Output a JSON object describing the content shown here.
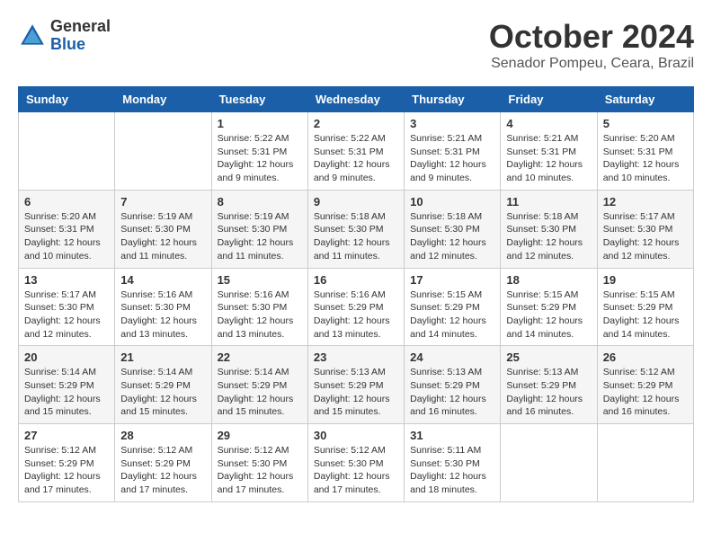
{
  "logo": {
    "general": "General",
    "blue": "Blue"
  },
  "title": "October 2024",
  "subtitle": "Senador Pompeu, Ceara, Brazil",
  "headers": [
    "Sunday",
    "Monday",
    "Tuesday",
    "Wednesday",
    "Thursday",
    "Friday",
    "Saturday"
  ],
  "weeks": [
    [
      {
        "day": "",
        "info": ""
      },
      {
        "day": "",
        "info": ""
      },
      {
        "day": "1",
        "info": "Sunrise: 5:22 AM\nSunset: 5:31 PM\nDaylight: 12 hours and 9 minutes."
      },
      {
        "day": "2",
        "info": "Sunrise: 5:22 AM\nSunset: 5:31 PM\nDaylight: 12 hours and 9 minutes."
      },
      {
        "day": "3",
        "info": "Sunrise: 5:21 AM\nSunset: 5:31 PM\nDaylight: 12 hours and 9 minutes."
      },
      {
        "day": "4",
        "info": "Sunrise: 5:21 AM\nSunset: 5:31 PM\nDaylight: 12 hours and 10 minutes."
      },
      {
        "day": "5",
        "info": "Sunrise: 5:20 AM\nSunset: 5:31 PM\nDaylight: 12 hours and 10 minutes."
      }
    ],
    [
      {
        "day": "6",
        "info": "Sunrise: 5:20 AM\nSunset: 5:31 PM\nDaylight: 12 hours and 10 minutes."
      },
      {
        "day": "7",
        "info": "Sunrise: 5:19 AM\nSunset: 5:30 PM\nDaylight: 12 hours and 11 minutes."
      },
      {
        "day": "8",
        "info": "Sunrise: 5:19 AM\nSunset: 5:30 PM\nDaylight: 12 hours and 11 minutes."
      },
      {
        "day": "9",
        "info": "Sunrise: 5:18 AM\nSunset: 5:30 PM\nDaylight: 12 hours and 11 minutes."
      },
      {
        "day": "10",
        "info": "Sunrise: 5:18 AM\nSunset: 5:30 PM\nDaylight: 12 hours and 12 minutes."
      },
      {
        "day": "11",
        "info": "Sunrise: 5:18 AM\nSunset: 5:30 PM\nDaylight: 12 hours and 12 minutes."
      },
      {
        "day": "12",
        "info": "Sunrise: 5:17 AM\nSunset: 5:30 PM\nDaylight: 12 hours and 12 minutes."
      }
    ],
    [
      {
        "day": "13",
        "info": "Sunrise: 5:17 AM\nSunset: 5:30 PM\nDaylight: 12 hours and 12 minutes."
      },
      {
        "day": "14",
        "info": "Sunrise: 5:16 AM\nSunset: 5:30 PM\nDaylight: 12 hours and 13 minutes."
      },
      {
        "day": "15",
        "info": "Sunrise: 5:16 AM\nSunset: 5:30 PM\nDaylight: 12 hours and 13 minutes."
      },
      {
        "day": "16",
        "info": "Sunrise: 5:16 AM\nSunset: 5:29 PM\nDaylight: 12 hours and 13 minutes."
      },
      {
        "day": "17",
        "info": "Sunrise: 5:15 AM\nSunset: 5:29 PM\nDaylight: 12 hours and 14 minutes."
      },
      {
        "day": "18",
        "info": "Sunrise: 5:15 AM\nSunset: 5:29 PM\nDaylight: 12 hours and 14 minutes."
      },
      {
        "day": "19",
        "info": "Sunrise: 5:15 AM\nSunset: 5:29 PM\nDaylight: 12 hours and 14 minutes."
      }
    ],
    [
      {
        "day": "20",
        "info": "Sunrise: 5:14 AM\nSunset: 5:29 PM\nDaylight: 12 hours and 15 minutes."
      },
      {
        "day": "21",
        "info": "Sunrise: 5:14 AM\nSunset: 5:29 PM\nDaylight: 12 hours and 15 minutes."
      },
      {
        "day": "22",
        "info": "Sunrise: 5:14 AM\nSunset: 5:29 PM\nDaylight: 12 hours and 15 minutes."
      },
      {
        "day": "23",
        "info": "Sunrise: 5:13 AM\nSunset: 5:29 PM\nDaylight: 12 hours and 15 minutes."
      },
      {
        "day": "24",
        "info": "Sunrise: 5:13 AM\nSunset: 5:29 PM\nDaylight: 12 hours and 16 minutes."
      },
      {
        "day": "25",
        "info": "Sunrise: 5:13 AM\nSunset: 5:29 PM\nDaylight: 12 hours and 16 minutes."
      },
      {
        "day": "26",
        "info": "Sunrise: 5:12 AM\nSunset: 5:29 PM\nDaylight: 12 hours and 16 minutes."
      }
    ],
    [
      {
        "day": "27",
        "info": "Sunrise: 5:12 AM\nSunset: 5:29 PM\nDaylight: 12 hours and 17 minutes."
      },
      {
        "day": "28",
        "info": "Sunrise: 5:12 AM\nSunset: 5:29 PM\nDaylight: 12 hours and 17 minutes."
      },
      {
        "day": "29",
        "info": "Sunrise: 5:12 AM\nSunset: 5:30 PM\nDaylight: 12 hours and 17 minutes."
      },
      {
        "day": "30",
        "info": "Sunrise: 5:12 AM\nSunset: 5:30 PM\nDaylight: 12 hours and 17 minutes."
      },
      {
        "day": "31",
        "info": "Sunrise: 5:11 AM\nSunset: 5:30 PM\nDaylight: 12 hours and 18 minutes."
      },
      {
        "day": "",
        "info": ""
      },
      {
        "day": "",
        "info": ""
      }
    ]
  ]
}
